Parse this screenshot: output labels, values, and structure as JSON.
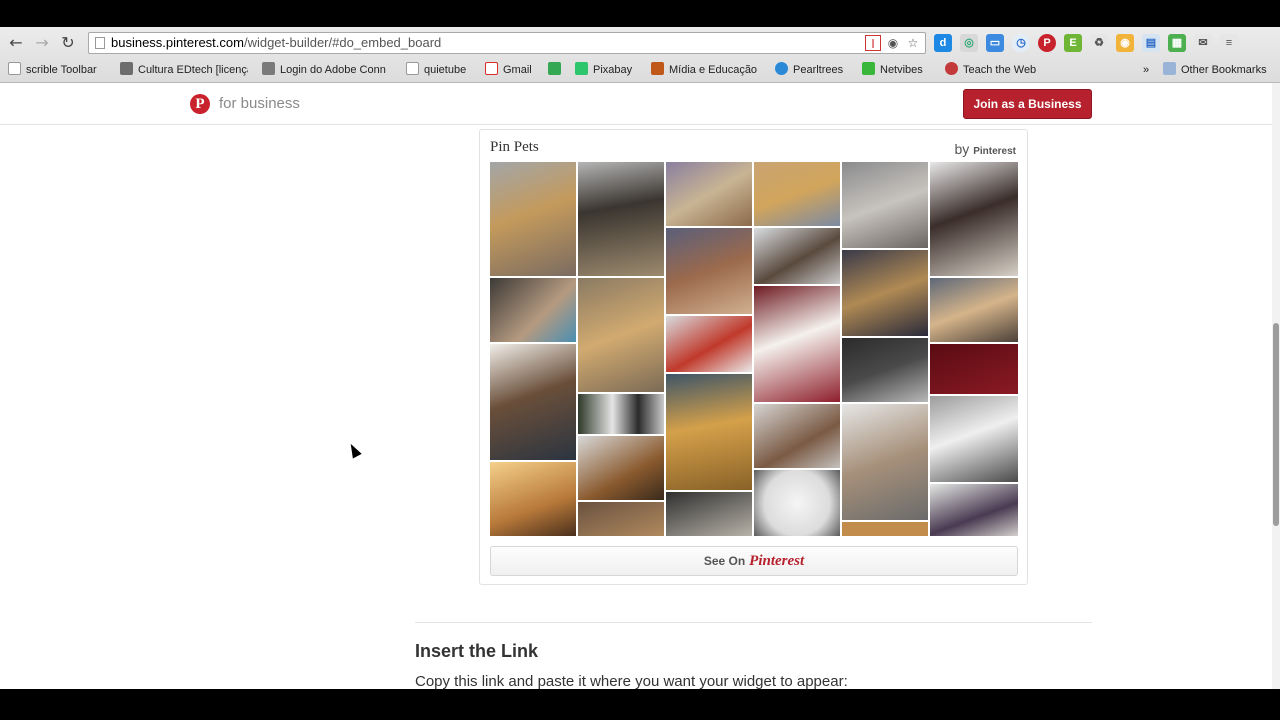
{
  "browser": {
    "url_host": "business.pinterest.com",
    "url_path": "/widget-builder/#do_embed_board",
    "back_icon": "arrow-left-icon",
    "forward_icon": "arrow-right-icon",
    "reload_icon": "reload-icon",
    "bookmarks": [
      {
        "label": "scrible Toolbar",
        "icon": "page-icon",
        "color": "#ffffff"
      },
      {
        "label": "Cultura EDtech [licença",
        "icon": "pb-icon",
        "color": "#6d6d6d"
      },
      {
        "label": "Login do Adobe Conn",
        "icon": "adobe-icon",
        "color": "#7a7a7a"
      },
      {
        "label": "quietube",
        "icon": "page-icon",
        "color": "#ffffff"
      },
      {
        "label": "Gmail",
        "icon": "gmail-icon",
        "color": "#d93025"
      },
      {
        "label": "",
        "icon": "drive-icon",
        "color": "#34a853"
      },
      {
        "label": "Pixabay",
        "icon": "pixabay-icon",
        "color": "#2ec66d"
      },
      {
        "label": "Mídia e Educação",
        "icon": "media-icon",
        "color": "#c0581a"
      },
      {
        "label": "Pearltrees",
        "icon": "pearltrees-icon",
        "color": "#2a8ad8"
      },
      {
        "label": "Netvibes",
        "icon": "netvibes-icon",
        "color": "#3ab63a"
      },
      {
        "label": "Teach the Web",
        "icon": "mozilla-icon",
        "color": "#c33a3a"
      }
    ],
    "more_bookmarks": "»",
    "other_bookmarks": "Other Bookmarks"
  },
  "page": {
    "brand": "for business",
    "join_button": "Join as a Business",
    "widget": {
      "board_title": "Pin Pets",
      "by": "by",
      "by_brand": "Pinterest",
      "see_on": "See On",
      "see_on_brand": "Pinterest"
    },
    "section_title": "Insert the Link",
    "section_text": "Copy this link and paste it where you want your widget to appear:"
  }
}
